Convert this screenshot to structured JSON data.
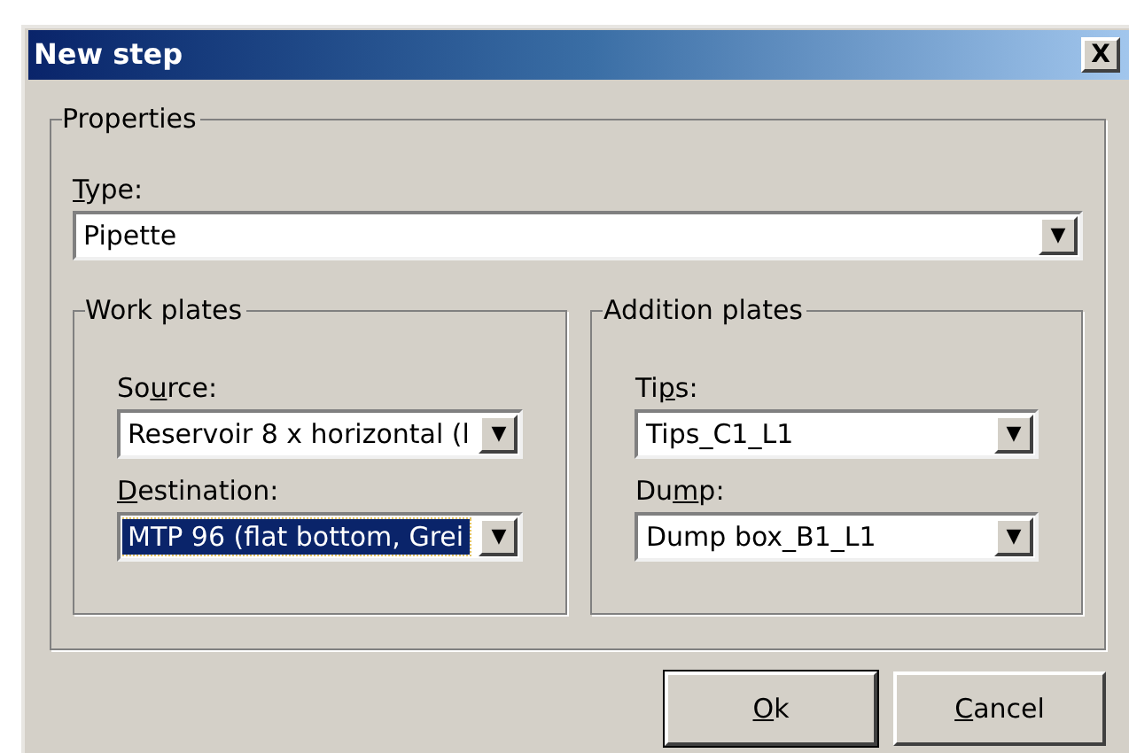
{
  "window": {
    "title": "New step",
    "close": "X"
  },
  "properties": {
    "title": "Properties",
    "type": {
      "label": {
        "key": "T",
        "after": "ype:"
      },
      "value": "Pipette",
      "focused": false,
      "arrow": "▼"
    },
    "groups": [
      {
        "title": "Work plates",
        "fields": [
          {
            "label": {
              "before": "So",
              "key": "u",
              "after": "rce:"
            },
            "value": "Reservoir 8 x horizontal (l",
            "focused": false,
            "arrow": "▼"
          },
          {
            "label": {
              "key": "D",
              "after": "estination:"
            },
            "value": "MTP 96 (flat bottom, Grei",
            "focused": true,
            "arrow": "▼"
          }
        ]
      },
      {
        "title": "Addition plates",
        "fields": [
          {
            "label": {
              "before": "Ti",
              "key": "p",
              "after": "s:"
            },
            "value": "Tips_C1_L1",
            "focused": false,
            "arrow": "▼"
          },
          {
            "label": {
              "before": "Du",
              "key": "m",
              "after": "p:"
            },
            "value": "Dump box_B1_L1",
            "focused": false,
            "arrow": "▼"
          }
        ]
      }
    ]
  },
  "buttons": [
    {
      "label": {
        "key": "O",
        "after": "k"
      },
      "default": true
    },
    {
      "label": {
        "key": "C",
        "after": "ancel"
      },
      "default": false
    }
  ]
}
